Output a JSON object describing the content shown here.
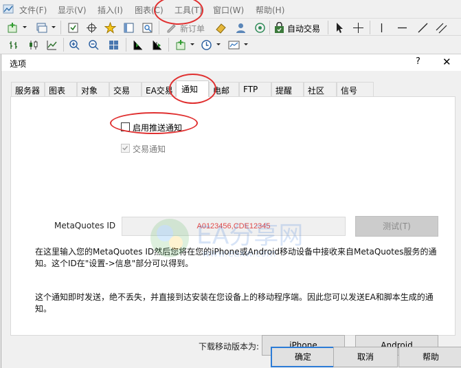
{
  "menu": [
    "文件(F)",
    "显示(V)",
    "插入(I)",
    "图表(C)",
    "工具(T)",
    "窗口(W)",
    "帮助(H)"
  ],
  "toolbar": {
    "new_order": "新订单",
    "auto_trade": "自动交易"
  },
  "dialog": {
    "title": "选项",
    "help_glyph": "?",
    "close_glyph": "✕",
    "tabs": [
      "服务器",
      "图表",
      "对象",
      "交易",
      "EA交易",
      "通知",
      "电邮",
      "FTP",
      "提醒",
      "社区",
      "信号"
    ],
    "active_tab": "通知"
  },
  "notifications": {
    "enable_push_label": "启用推送通知",
    "enable_push_checked": false,
    "trade_notify_label": "交易通知",
    "trade_notify_checked": true,
    "trade_notify_enabled": false,
    "id_label": "MetaQuotes ID",
    "id_value": "A0123456,CDE12345",
    "test_button": "测试(T)",
    "desc1": "在这里输入您的MetaQuotes ID然后您将在您的iPhone或Android移动设备中接收来自MetaQuotes服务的通知。这个ID在\"设置->信息\"部分可以得到。",
    "desc2": "这个通知即时发送，绝不丢失，并直接到达安装在您设备上的移动程序端。因此您可以发送EA和脚本生成的通知。",
    "download_label": "下载移动版本为:",
    "iphone_button": "iPhone",
    "android_button": "Android"
  },
  "footer": {
    "ok": "确定",
    "cancel": "取消",
    "help": "帮助"
  },
  "watermark": {
    "text": "EA分享网",
    "url": "www.eaxw.com"
  },
  "colors": {
    "annotation": "#e03030",
    "focus": "#2b7bd6",
    "id_text": "#e04848"
  }
}
